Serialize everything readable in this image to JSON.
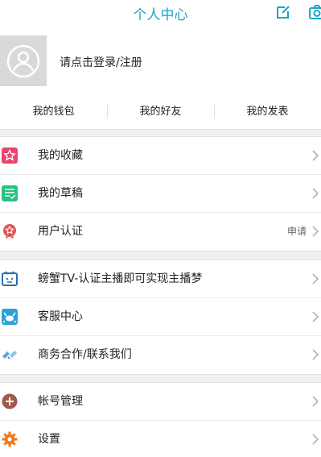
{
  "header": {
    "title": "个人中心"
  },
  "profile": {
    "login_text": "请点击登录/注册"
  },
  "quick_links": [
    "我的钱包",
    "我的好友",
    "我的发表"
  ],
  "menu": {
    "favorites": "我的收藏",
    "drafts": "我的草稿",
    "verification": "用户认证",
    "verification_extra": "申请",
    "tv": "螃蟹TV-认证主播即可实现主播梦",
    "support": "客服中心",
    "business": "商务合作/联系我们",
    "account": "帐号管理",
    "settings": "设置"
  },
  "colors": {
    "accent": "#1aa3c8",
    "favorites_icon": "#e9456f",
    "drafts_icon": "#26c281",
    "verification_icon": "#e05555",
    "tv_icon": "#2b6cb0",
    "support_icon": "#2ba3d6",
    "business_icon": "#5aa9e0",
    "account_icon": "#9e5a4a",
    "settings_icon": "#f07b1f"
  }
}
